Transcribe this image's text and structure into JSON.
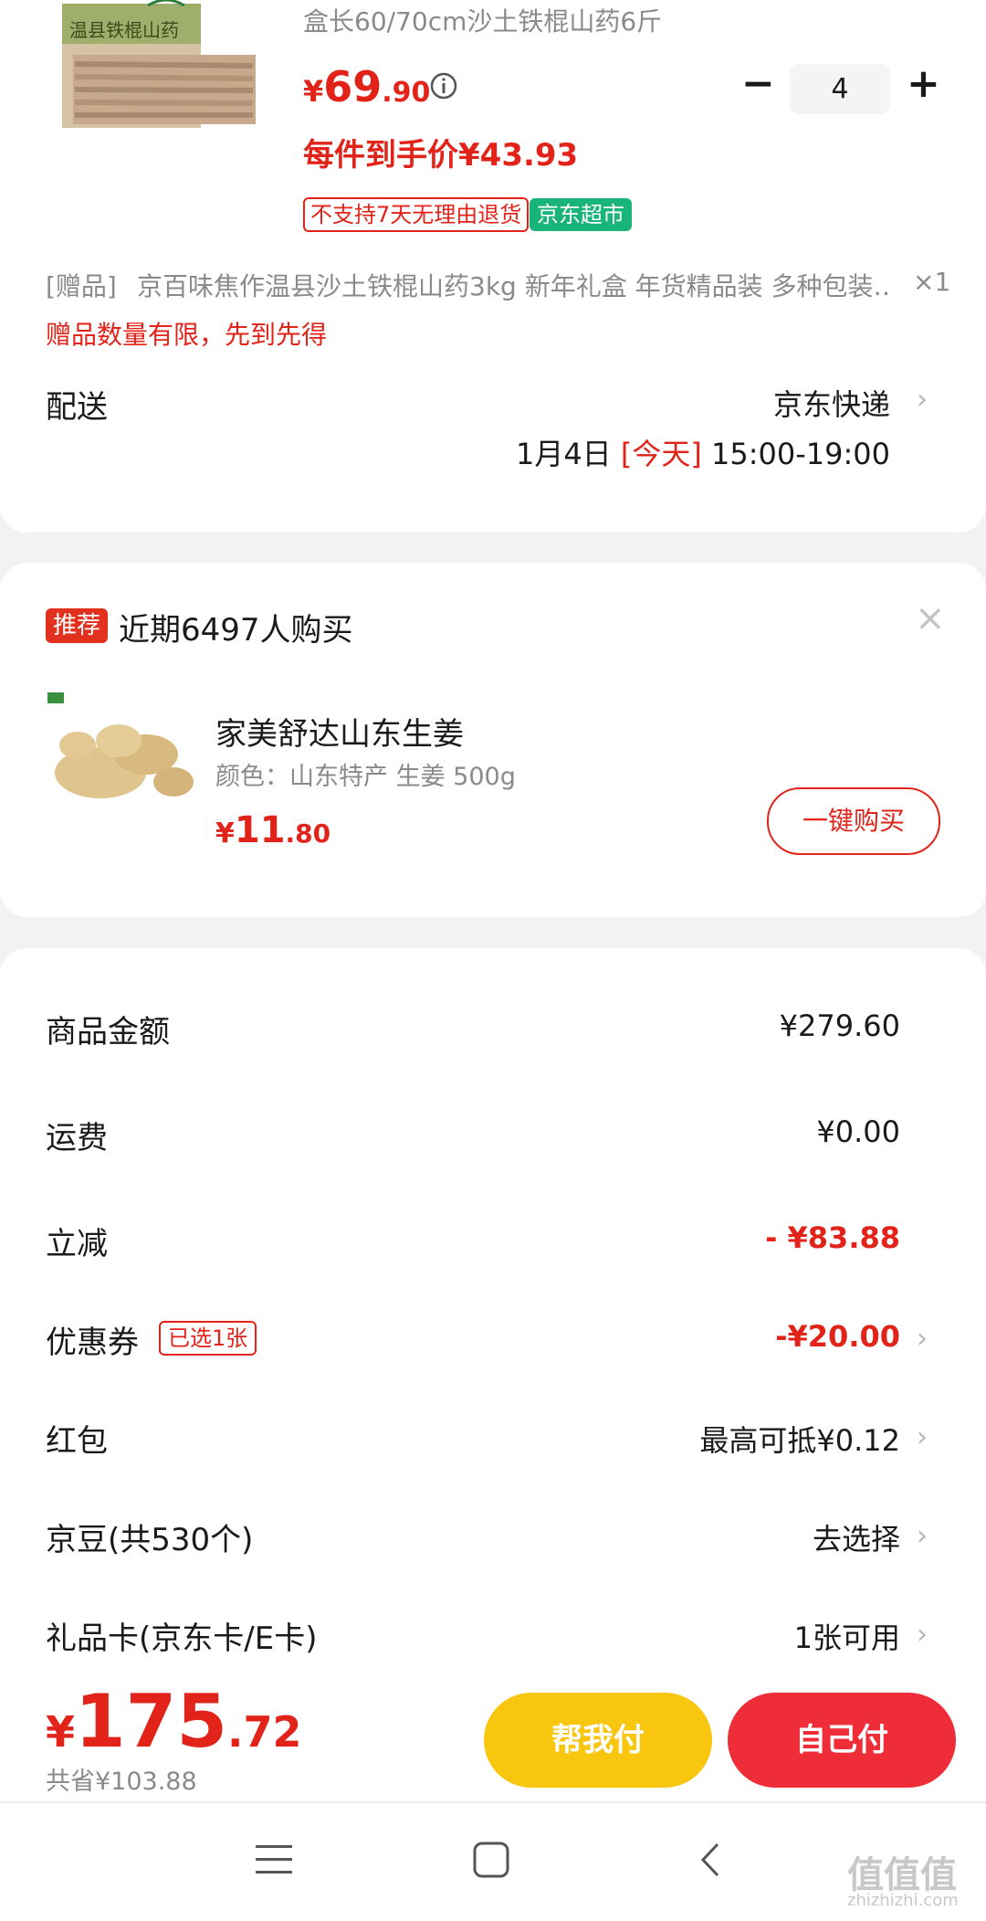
{
  "colors": {
    "accent": "#e2231a",
    "help_pay": "#f8c50f",
    "self_pay": "#ef2d38",
    "green_tag": "#19b479"
  },
  "product": {
    "subtitle": "盒长60/70cm沙土铁棍山药6斤",
    "price_currency": "¥",
    "price_int": "69",
    "price_dec": ".90",
    "info_icon": "info-circle-icon",
    "per_item_price": "每件到手价¥43.93",
    "quantity": "4",
    "minus": "−",
    "plus": "+",
    "tag_no_return": "不支持7天无理由退货",
    "tag_store": "京东超市",
    "box_text": "温县铁棍山药"
  },
  "gift": {
    "label": "[赠品]",
    "name": "京百味焦作温县沙土铁棍山药3kg 新年礼盒 年货精品装 多种包装…",
    "count": "×1",
    "notice": "赠品数量有限，先到先得"
  },
  "delivery": {
    "label": "配送",
    "carrier": "京东快递",
    "date": "1月4日",
    "today": "[今天]",
    "time": "15:00-19:00"
  },
  "recommend": {
    "badge": "推荐",
    "title": "近期6497人购买",
    "product_name": "家美舒达山东生姜",
    "spec": "颜色：山东特产   生姜 500g",
    "price_currency": "¥",
    "price_int": "11",
    "price_dec": ".80",
    "buy_button": "一键购买",
    "close": "×"
  },
  "summary": {
    "goods_label": "商品金额",
    "goods_value": "¥279.60",
    "shipping_label": "运费",
    "shipping_value": "¥0.00",
    "discount_label": "立减",
    "discount_value": "- ¥83.88",
    "coupon_label": "优惠券",
    "coupon_badge": "已选1张",
    "coupon_value": "-¥20.00",
    "redpacket_label": "红包",
    "redpacket_value": "最高可抵¥0.12",
    "jdbean_label": "京豆(共530个)",
    "jdbean_value": "去选择",
    "giftcard_label": "礼品卡(京东卡/E卡)",
    "giftcard_value": "1张可用"
  },
  "bottom": {
    "total_currency": "¥",
    "total_int": "175",
    "total_dec": ".72",
    "saved": "共省¥103.88",
    "help_pay": "帮我付",
    "self_pay": "自己付"
  },
  "nav": {
    "menu": "menu-icon",
    "home": "home-square-icon",
    "back": "back-chevron-icon"
  },
  "watermark": {
    "logo": "值值值",
    "url": "zhizhizhi.com"
  }
}
